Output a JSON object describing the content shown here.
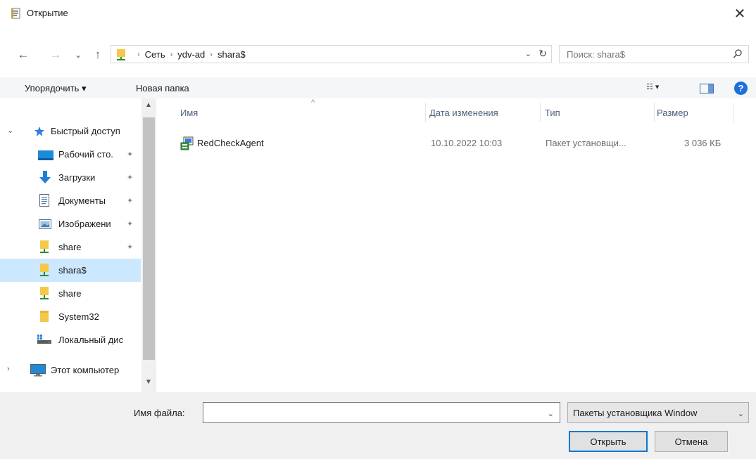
{
  "window": {
    "title": "Открытие",
    "close_glyph": "✕"
  },
  "nav": {
    "back_glyph": "←",
    "forward_glyph": "→",
    "recent_glyph": "⌄",
    "up_glyph": "↑"
  },
  "address": {
    "crumbs": [
      "Сеть",
      "ydv-ad",
      "shara$"
    ],
    "sep_glyph": "›",
    "dropdown_glyph": "⌄",
    "refresh_glyph": "↻"
  },
  "search": {
    "placeholder": "Поиск: shara$"
  },
  "toolbar": {
    "organize_label": "Упорядочить ▾",
    "new_folder_label": "Новая папка",
    "view_glyph": "☷ ▾",
    "help_glyph": "?"
  },
  "sidebar": {
    "items": [
      {
        "label": "Быстрый доступ",
        "icon": "star-icon"
      },
      {
        "label": "Рабочий сто.",
        "icon": "desktop-icon",
        "pinned": true
      },
      {
        "label": "Загрузки",
        "icon": "download-icon",
        "pinned": true
      },
      {
        "label": "Документы",
        "icon": "document-icon",
        "pinned": true
      },
      {
        "label": "Изображени",
        "icon": "image-icon",
        "pinned": true
      },
      {
        "label": "share",
        "icon": "network-folder-icon",
        "pinned": true
      },
      {
        "label": "shara$",
        "icon": "network-folder-icon",
        "selected": true
      },
      {
        "label": "share",
        "icon": "network-folder-icon"
      },
      {
        "label": "System32",
        "icon": "folder-icon"
      },
      {
        "label": "Локальный дис",
        "icon": "drive-icon"
      },
      {
        "label": "Этот компьютер",
        "icon": "computer-icon"
      }
    ],
    "pin_glyph": "📌",
    "expand_open": "⌄",
    "expand_closed": "›"
  },
  "files": {
    "columns": [
      "Имя",
      "Дата изменения",
      "Тип",
      "Размер"
    ],
    "sort_glyph": "^",
    "rows": [
      {
        "name": "RedCheckAgent",
        "modified": "10.10.2022 10:03",
        "type": "Пакет установщи...",
        "size": "3 036 КБ",
        "icon": "msi-package-icon"
      }
    ]
  },
  "footer": {
    "filename_label": "Имя файла:",
    "filename_value": "",
    "filter_value": "Пакеты установщика Window",
    "open_label": "Открыть",
    "cancel_label": "Отмена"
  },
  "colors": {
    "accent": "#0078d7",
    "selection": "#cce8ff",
    "folder": "#f4c94a",
    "network_green": "#2e8b2e"
  }
}
